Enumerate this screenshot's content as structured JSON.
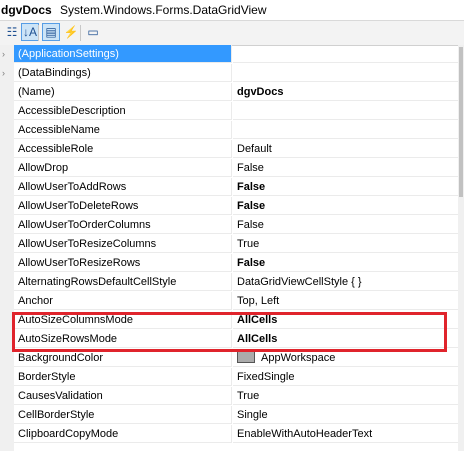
{
  "header": {
    "object_name": "dgvDocs",
    "object_type": "System.Windows.Forms.DataGridView"
  },
  "toolbar": {
    "buttons": [
      {
        "name": "categorized-button",
        "icon": "categorized-icon",
        "glyph": "☷"
      },
      {
        "name": "alphabetical-button",
        "icon": "alphabetical-sort-icon",
        "glyph": "↓A",
        "active": true
      },
      {
        "name": "properties-button",
        "icon": "properties-icon",
        "glyph": "▤",
        "active": true
      },
      {
        "name": "events-button",
        "icon": "lightning-events-icon",
        "glyph": "⚡"
      },
      {
        "name": "property-pages-button",
        "icon": "property-pages-icon",
        "glyph": "▭"
      }
    ]
  },
  "properties": [
    {
      "name": "(ApplicationSettings)",
      "value": "",
      "expandable": true,
      "selected": true
    },
    {
      "name": "(DataBindings)",
      "value": "",
      "expandable": true
    },
    {
      "name": "(Name)",
      "value": "dgvDocs",
      "bold": true
    },
    {
      "name": "AccessibleDescription",
      "value": ""
    },
    {
      "name": "AccessibleName",
      "value": ""
    },
    {
      "name": "AccessibleRole",
      "value": "Default"
    },
    {
      "name": "AllowDrop",
      "value": "False"
    },
    {
      "name": "AllowUserToAddRows",
      "value": "False",
      "bold": true
    },
    {
      "name": "AllowUserToDeleteRows",
      "value": "False",
      "bold": true
    },
    {
      "name": "AllowUserToOrderColumns",
      "value": "False"
    },
    {
      "name": "AllowUserToResizeColumns",
      "value": "True"
    },
    {
      "name": "AllowUserToResizeRows",
      "value": "False",
      "bold": true
    },
    {
      "name": "AlternatingRowsDefaultCellStyle",
      "value": "DataGridViewCellStyle { }"
    },
    {
      "name": "Anchor",
      "value": "Top, Left"
    },
    {
      "name": "AutoSizeColumnsMode",
      "value": "AllCells",
      "bold": true
    },
    {
      "name": "AutoSizeRowsMode",
      "value": "AllCells",
      "bold": true
    },
    {
      "name": "BackgroundColor",
      "value": "AppWorkspace",
      "swatch": "#ababab"
    },
    {
      "name": "BorderStyle",
      "value": "FixedSingle"
    },
    {
      "name": "CausesValidation",
      "value": "True"
    },
    {
      "name": "CellBorderStyle",
      "value": "Single"
    },
    {
      "name": "ClipboardCopyMode",
      "value": "EnableWithAutoHeaderText"
    }
  ],
  "highlight": {
    "color": "#e0242c",
    "rows": [
      "AutoSizeColumnsMode",
      "AutoSizeRowsMode"
    ]
  }
}
